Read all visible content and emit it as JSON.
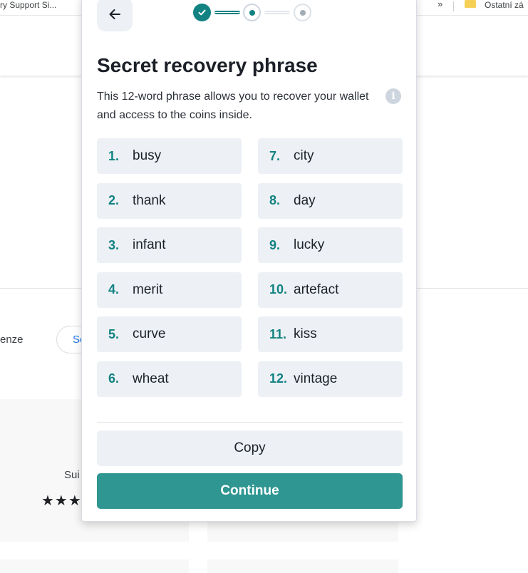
{
  "browser": {
    "bookmark_left": "ry Support Si...",
    "bookmark_more": "»",
    "bookmark_right": "Ostatní zá"
  },
  "background": {
    "left_text": "enze",
    "pill_text": "Se",
    "card_text": "Sui",
    "stars": "★★★"
  },
  "popup": {
    "back_icon": "arrow-left-icon",
    "title": "Secret recovery phrase",
    "description": "This 12-word phrase allows you to recover your wallet and access to the coins inside.",
    "info_icon": "i",
    "words": [
      {
        "num": "1.",
        "word": "busy"
      },
      {
        "num": "7.",
        "word": "city"
      },
      {
        "num": "2.",
        "word": "thank"
      },
      {
        "num": "8.",
        "word": "day"
      },
      {
        "num": "3.",
        "word": "infant"
      },
      {
        "num": "9.",
        "word": "lucky"
      },
      {
        "num": "4.",
        "word": "merit"
      },
      {
        "num": "10.",
        "word": "artefact"
      },
      {
        "num": "5.",
        "word": "curve"
      },
      {
        "num": "11.",
        "word": "kiss"
      },
      {
        "num": "6.",
        "word": "wheat"
      },
      {
        "num": "12.",
        "word": "vintage"
      }
    ],
    "copy_label": "Copy",
    "continue_label": "Continue"
  },
  "colors": {
    "accent": "#128282",
    "primary_button": "#2f9691",
    "card_bg": "#edf1f5"
  }
}
